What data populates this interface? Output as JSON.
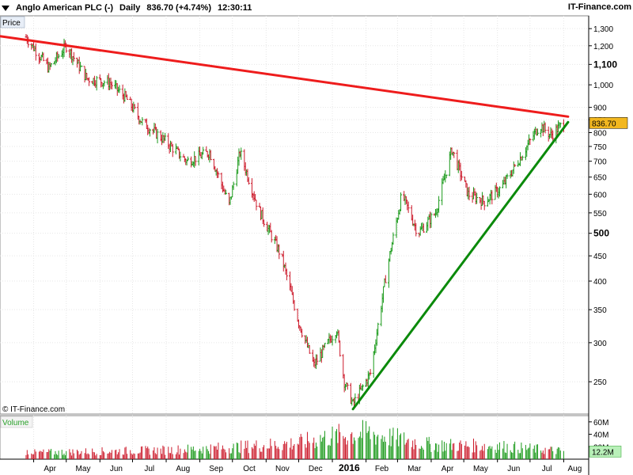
{
  "header": {
    "instrument": "Anglo American PLC (-)",
    "interval": "Daily",
    "last": "836.70 (+4.74%)",
    "time": "12:30:11",
    "brand": "IT-Finance.com"
  },
  "panels": {
    "price_label": "Price",
    "volume_label": "Volume",
    "copyright": "© IT-Finance.com"
  },
  "colors": {
    "up": "#1b9a1b",
    "down": "#cc1a2b",
    "resistance": "#ee1c1c",
    "support": "#0b8a0b",
    "marker": "#f2b71f",
    "volmarker": "#b9f0b9"
  },
  "chart_data": [
    {
      "type": "line",
      "title": "Anglo American PLC (-)",
      "yscale": "log",
      "ylim": [
        215,
        1380
      ],
      "y_ticks": [
        "1,300",
        "1,200",
        "1,100",
        "1,000",
        "900",
        "850",
        "800",
        "750",
        "700",
        "650",
        "600",
        "550",
        "500",
        "450",
        "400",
        "350",
        "300",
        "250"
      ],
      "x_labels": [
        "Apr",
        "May",
        "Jun",
        "Jul",
        "Aug",
        "Sep",
        "Oct",
        "Nov",
        "Dec",
        "2016",
        "Feb",
        "Mar",
        "Apr",
        "May",
        "Jun",
        "Jul",
        "Aug"
      ],
      "last_value_label": "836.70",
      "series": [
        {
          "x": [
            "2015-03-25",
            "2015-04-15",
            "2015-05-01",
            "2015-05-20",
            "2015-06-10",
            "2015-06-25",
            "2015-07-10",
            "2015-07-28",
            "2015-08-20",
            "2015-09-10",
            "2015-09-28",
            "2015-10-08",
            "2015-10-25",
            "2015-11-15",
            "2015-12-01",
            "2015-12-15",
            "2016-01-05",
            "2016-01-12",
            "2016-01-20",
            "2016-02-05",
            "2016-02-20",
            "2016-03-05",
            "2016-03-20",
            "2016-04-05",
            "2016-04-20",
            "2016-05-05",
            "2016-05-20",
            "2016-06-05",
            "2016-06-20",
            "2016-07-10",
            "2016-07-20",
            "2016-08-01"
          ],
          "values": [
            1250,
            1080,
            1200,
            1030,
            1010,
            940,
            840,
            780,
            700,
            730,
            570,
            730,
            560,
            450,
            330,
            270,
            320,
            250,
            225,
            260,
            420,
            600,
            500,
            550,
            740,
            600,
            580,
            620,
            700,
            830,
            790,
            836.7
          ]
        }
      ],
      "trendlines": [
        {
          "name": "resistance",
          "x": [
            "2015-03-01",
            "2016-08-05"
          ],
          "values": [
            1255,
            862
          ]
        },
        {
          "name": "support",
          "x": [
            "2016-01-20",
            "2016-08-05"
          ],
          "values": [
            220,
            840
          ]
        }
      ]
    },
    {
      "type": "bar",
      "title": "Volume",
      "y_ticks": [
        "60M",
        "40M",
        "20M"
      ],
      "last_value_label": "12.2M",
      "x": [
        "2015-04",
        "2015-06",
        "2015-08",
        "2015-10",
        "2015-12",
        "2016-01",
        "2016-02",
        "2016-04",
        "2016-06",
        "2016-08"
      ],
      "values": [
        10,
        12,
        14,
        18,
        25,
        35,
        40,
        22,
        20,
        12.2
      ]
    }
  ]
}
